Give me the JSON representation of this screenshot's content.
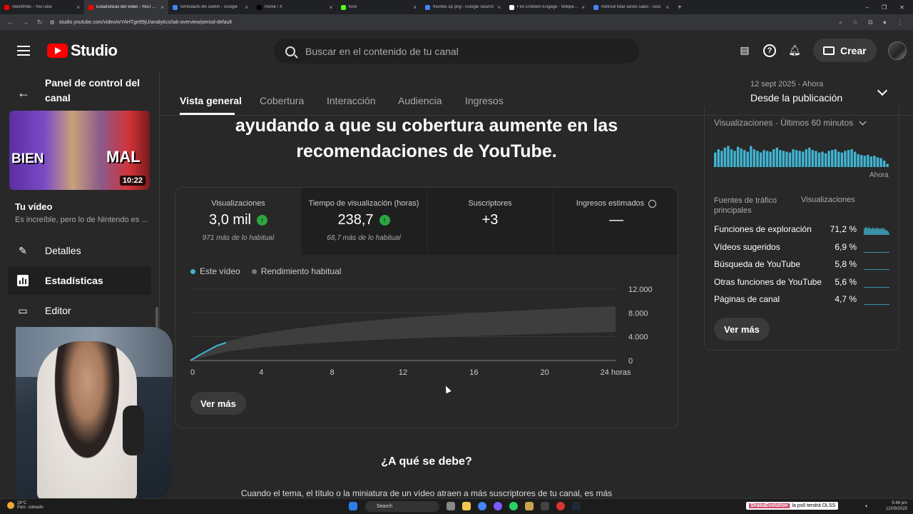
{
  "browser": {
    "tabs": [
      {
        "title": "AlexWhite - YouTube",
        "color": "#ff0000",
        "active": false
      },
      {
        "title": "Estadísticas del vídeo - YouTube",
        "color": "#ff0000",
        "active": true
      },
      {
        "title": "tomodachi life switch - Google",
        "color": "#4285f4",
        "active": false
      },
      {
        "title": "Home / X",
        "color": "#000000",
        "active": false
      },
      {
        "title": "Kick",
        "color": "#53fc18",
        "active": false
      },
      {
        "title": "thumbs up png - Google Search",
        "color": "#4285f4",
        "active": false
      },
      {
        "title": "Fire Emblem Engage - Wikipedia",
        "color": "#ffffff",
        "active": false
      },
      {
        "title": "metroid total series sales - Goo",
        "color": "#4285f4",
        "active": false
      }
    ],
    "url": "studio.youtube.com/video/wYAHTge99jU/analytics/tab-overview/period-default"
  },
  "header": {
    "logo_text": "Studio",
    "search_placeholder": "Buscar en el contenido de tu canal",
    "create_label": "Crear"
  },
  "sidebar": {
    "panel_title": "Panel de control del canal",
    "thumb_left": "BIEN",
    "thumb_right": "MAL",
    "duration": "10:22",
    "your_video": "Tu vídeo",
    "video_title": "Es increíble, pero lo de Nintendo es ...",
    "items": [
      {
        "label": "Detalles",
        "icon": "pencil-icon"
      },
      {
        "label": "Estadísticas",
        "icon": "analytics-icon",
        "active": true
      },
      {
        "label": "Editor",
        "icon": "editor-icon"
      }
    ]
  },
  "tabs": {
    "items": [
      "Vista general",
      "Cobertura",
      "Interacción",
      "Audiencia",
      "Ingresos"
    ],
    "active": 0
  },
  "date_range": {
    "period": "12 sept 2025 - Ahora",
    "label": "Desde la publicación"
  },
  "main": {
    "headline": "ayudando a que su cobertura aumente en las recomendaciones de YouTube.",
    "metrics": [
      {
        "label": "Visualizaciones",
        "value": "3,0 mil",
        "sub": "971 más de lo habitual",
        "up": true
      },
      {
        "label": "Tiempo de visualización (horas)",
        "value": "238,7",
        "sub": "68,7 más de lo habitual",
        "up": true
      },
      {
        "label": "Suscriptores",
        "value": "+3",
        "sub": "",
        "up": false
      },
      {
        "label": "Ingresos estimados",
        "value": "—",
        "sub": "",
        "up": false
      }
    ],
    "see_more": "Ver más",
    "why_title": "¿A qué se debe?",
    "why_text": "Cuando el tema, el título o la miniatura de un vídeo atraen a más suscriptores de tu canal, es más"
  },
  "chart_data": {
    "type": "line",
    "series": [
      {
        "name": "Este vídeo",
        "color": "#41b4d2",
        "x": [
          0,
          0.5,
          1,
          1.5,
          2
        ],
        "y": [
          0,
          900,
          1700,
          2500,
          3000
        ]
      },
      {
        "name": "Rendimiento habitual",
        "color": "#606060",
        "x": [
          0,
          2,
          4,
          6,
          8,
          10,
          12,
          14,
          16,
          18,
          20,
          22,
          24
        ],
        "y_low": [
          0,
          1500,
          2200,
          2700,
          3100,
          3400,
          3700,
          3900,
          4100,
          4300,
          4500,
          4650,
          4800
        ],
        "y_high": [
          0,
          3200,
          4500,
          5400,
          6100,
          6700,
          7200,
          7600,
          8000,
          8300,
          8600,
          8900,
          9100
        ]
      }
    ],
    "x_ticks": [
      "0",
      "4",
      "8",
      "12",
      "16",
      "20",
      "24 horas"
    ],
    "y_ticks": [
      "0",
      "4.000",
      "8.000",
      "12.000"
    ],
    "xlim": [
      0,
      24
    ],
    "ylim": [
      0,
      12000
    ],
    "grid": true
  },
  "realtime": {
    "title": "Visualizaciones · Últimos 60 minutos",
    "now_label": "Ahora",
    "bars": [
      18,
      22,
      20,
      24,
      26,
      22,
      20,
      25,
      23,
      21,
      19,
      26,
      22,
      20,
      18,
      21,
      20,
      19,
      22,
      24,
      21,
      20,
      19,
      18,
      22,
      21,
      20,
      19,
      22,
      24,
      21,
      20,
      18,
      19,
      17,
      20,
      21,
      22,
      19,
      18,
      20,
      21,
      22,
      19,
      16,
      15,
      14,
      15,
      13,
      14,
      12,
      11,
      8,
      4
    ],
    "color": "#41b4d2",
    "sources_header": "Fuentes de tráfico principales",
    "views_header": "Visualizaciones",
    "sources": [
      {
        "name": "Funciones de exploración",
        "pct": "71,2 %"
      },
      {
        "name": "Vídeos sugeridos",
        "pct": "6,9 %"
      },
      {
        "name": "Búsqueda de YouTube",
        "pct": "5,8 %"
      },
      {
        "name": "Otras funciones de YouTube",
        "pct": "5,6 %"
      },
      {
        "name": "Páginas de canal",
        "pct": "4,7 %"
      }
    ],
    "see_more": "Ver más"
  },
  "taskbar": {
    "temp": "28°C",
    "weather": "Parc. soleado",
    "search": "Search",
    "ticker_user": "ShakaEvolution",
    "ticker_msg": ": la ps6 tendrá DLSS",
    "time": "5:48 pm",
    "date": "12/09/2025"
  }
}
